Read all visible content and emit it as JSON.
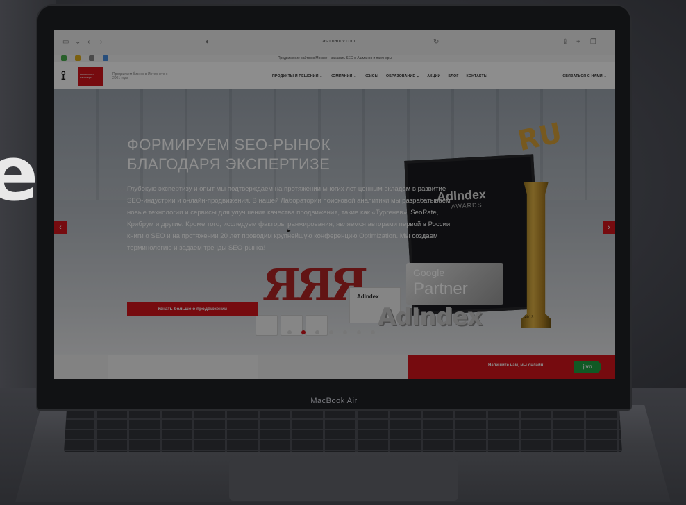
{
  "background": {
    "partial_text": "e"
  },
  "laptop": {
    "model_label": "MacBook Air"
  },
  "browser": {
    "url": "ashmanov.com",
    "tab_title": "Продвижение сайтов в Москве – заказать SEO в Ашманов и партнеры",
    "icons": [
      "sidebar-icon",
      "back-icon",
      "forward-icon",
      "shield-icon",
      "reload-icon",
      "share-icon",
      "new-tab-icon",
      "tabs-icon"
    ]
  },
  "site": {
    "logo_text": "Ашманов и партнеры",
    "tagline": "Продвигаем бизнес в Интернете с 2001 года",
    "nav": [
      "ПРОДУКТЫ И РЕШЕНИЯ ⌄",
      "КОМПАНИЯ ⌄",
      "КЕЙСЫ",
      "ОБРАЗОВАНИЕ ⌄",
      "АКЦИИ",
      "БЛОГ",
      "КОНТАКТЫ"
    ],
    "contact_label": "СВЯЗАТЬСЯ С НАМИ ⌄",
    "hero": {
      "title_line1": "ФОРМИРУЕМ SEO-РЫНОК",
      "title_line2": "БЛАГОДАРЯ ЭКСПЕРТИЗЕ",
      "text": "Глубокую экспертизу и опыт мы подтверждаем на протяжении многих лет ценным вкладом в развитие SEO-индустрии и онлайн-продвижения. В нашей Лаборатории поисковой аналитики мы разрабатываем новые технологии и сервисы для улучшения качества продвижения, такие как «Тургенев», SeoRate, Крибрум и другие. Кроме того, исследуем факторы ранжирования, являемся авторами первой в России книги о SEO и на протяжении 20 лет проводим крупнейшую конференцию Optimization. Мы создаем терминологию и задаем тренды SEO-рынка!",
      "button_label": "Узнать больше о продвижении",
      "slides": 7,
      "active_slide": 2,
      "awards": {
        "frame_title": "AdIndex",
        "frame_subtitle": "AWARDS",
        "trophy": "RU",
        "google": "Google",
        "partner": "Partner",
        "plaque": "AdIndex",
        "big_word": "AdIndex",
        "year": "2013",
        "letters": "ЯЯЯ"
      }
    },
    "chat": {
      "label": "Напишите нам, мы онлайн!",
      "badge": "jivo"
    }
  },
  "colors": {
    "brand_red": "#d71920",
    "chat_green": "#23a345"
  }
}
